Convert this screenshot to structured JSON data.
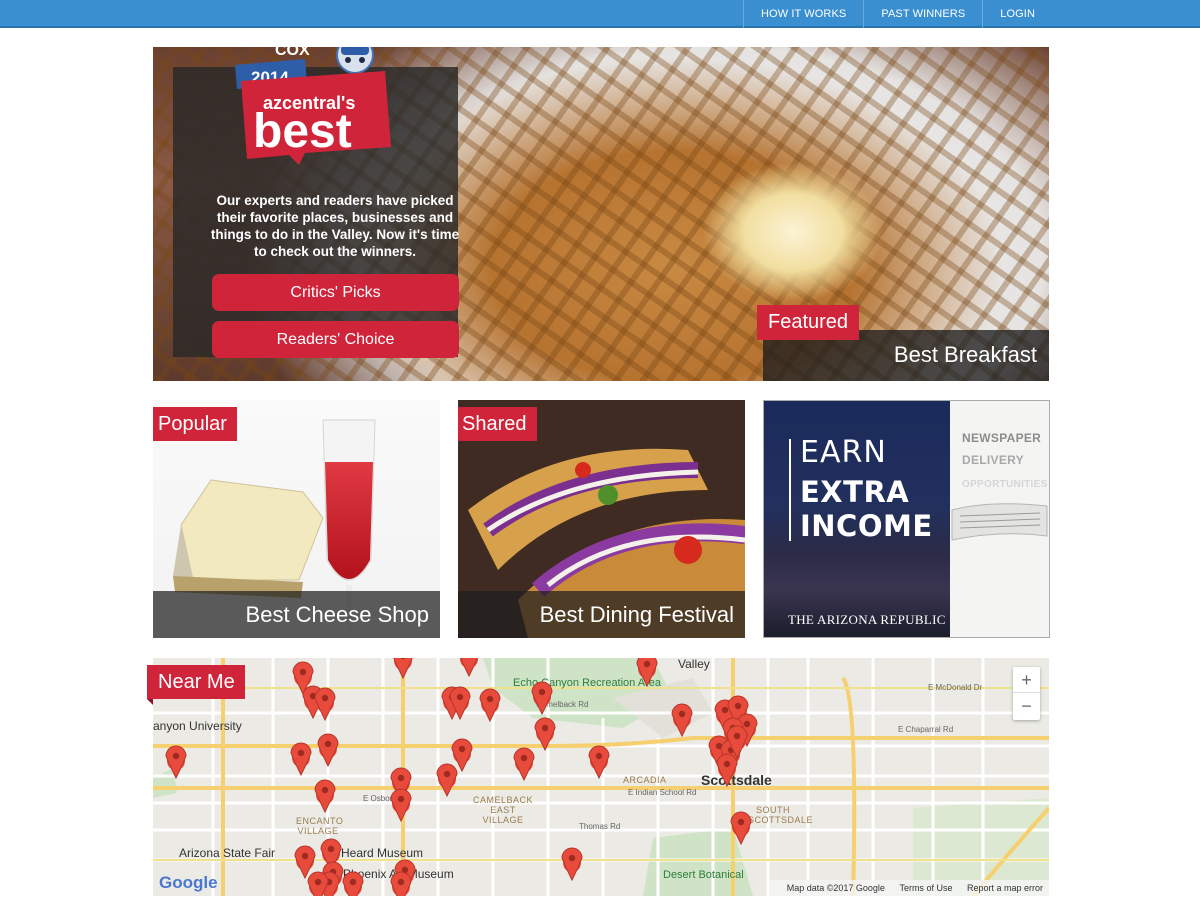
{
  "nav": {
    "items": [
      "HOW IT WORKS",
      "PAST WINNERS",
      "LOGIN"
    ]
  },
  "hero": {
    "logo": {
      "sponsor": "COX",
      "year": "2014",
      "brand_line": "azcentral's",
      "brand_word": "best"
    },
    "intro": "Our experts and readers have picked their favorite places, businesses and things to do in the Valley. Now it's time to check out the winners.",
    "buttons": [
      "Critics' Picks",
      "Readers' Choice"
    ],
    "tag": "Featured",
    "caption": "Best Breakfast"
  },
  "cards": [
    {
      "tag": "Popular",
      "caption": "Best Cheese Shop"
    },
    {
      "tag": "Shared",
      "caption": "Best Dining Festival"
    }
  ],
  "ad": {
    "earn": "EARN",
    "extra": "EXTRA",
    "income": "INCOME",
    "publisher": "THE ARIZONA REPUBLIC",
    "line1": "NEWSPAPER",
    "line2": "DELIVERY",
    "line3": "OPPORTUNITIES"
  },
  "map": {
    "tag": "Near Me",
    "zoom_in": "+",
    "zoom_out": "−",
    "google": "Google",
    "attribution": [
      "Map data ©2017 Google",
      "Terms of Use",
      "Report a map error"
    ],
    "labels": {
      "scottsdale": "Scottsdale",
      "arizona_state_fair": "Arizona State Fair",
      "heard_museum": "Heard Museum",
      "phoenix_art_museum": "Phoenix Art Museum",
      "echo_canyon": "Echo Canyon Recreation Area",
      "valley": "Valley",
      "canyon_university": "anyon University",
      "arcadia": "ARCADIA",
      "camelback_east": "CAMELBACK EAST VILLAGE",
      "encanto": "ENCANTO VILLAGE",
      "south_scottsdale": "SOUTH SCOTTSDALE",
      "desert_botanical": "Desert Botanical",
      "thomas_rd": "Thomas Rd",
      "camelback_rd": "Camelback Rd",
      "indian_school": "E Indian School Rd",
      "e_mcdonald": "E McDonald Dr",
      "e_chaparral": "E Chaparral Rd",
      "e_osborn": "E Osborn"
    }
  }
}
